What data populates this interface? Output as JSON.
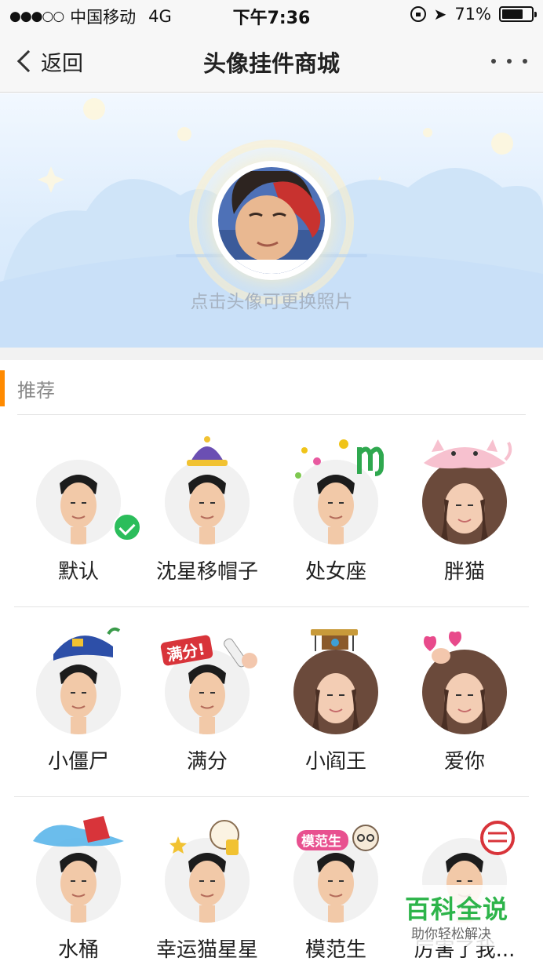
{
  "status_bar": {
    "carrier": "中国移动",
    "network": "4G",
    "time": "下午7:36",
    "battery": "71%",
    "battery_level": 0.71
  },
  "nav": {
    "back_label": "返回",
    "title": "头像挂件商城"
  },
  "banner": {
    "hint": "点击头像可更换照片"
  },
  "section": {
    "title": "推荐"
  },
  "items": [
    {
      "label": "默认",
      "selected": true
    },
    {
      "label": "沈星移帽子"
    },
    {
      "label": "处女座"
    },
    {
      "label": "胖猫"
    },
    {
      "label": "小僵尸"
    },
    {
      "label": "满分"
    },
    {
      "label": "小阎王"
    },
    {
      "label": "爱你"
    },
    {
      "label": "水桶"
    },
    {
      "label": "幸运猫星星"
    },
    {
      "label": "模范生"
    },
    {
      "label": "厉害了我..."
    }
  ],
  "decor_text": {
    "full_score": "满分!",
    "role_model": "模范生"
  },
  "watermark": {
    "title": "百科全说",
    "subtitle": "助你轻松解决"
  },
  "colors": {
    "accent": "#ff8a00",
    "check": "#2bbd5b",
    "watermark": "#2db44a"
  }
}
